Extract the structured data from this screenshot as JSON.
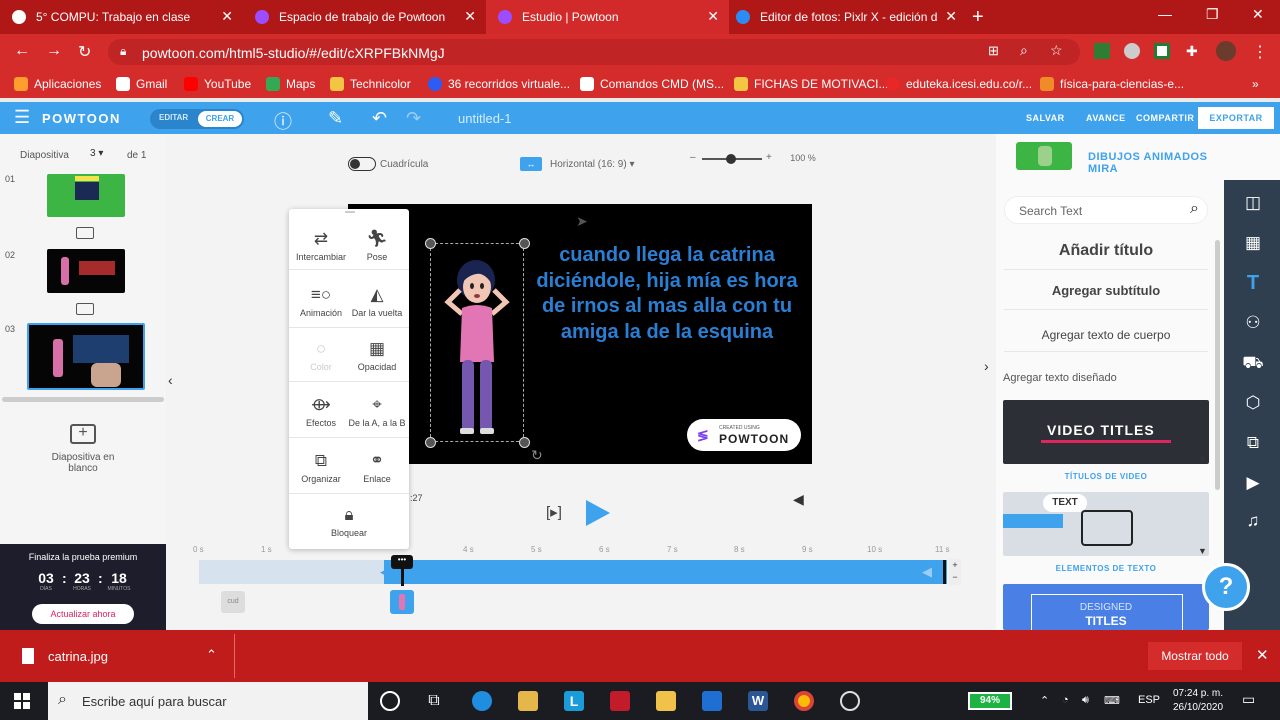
{
  "browser": {
    "tabs": [
      {
        "title": "5° COMPU: Trabajo en clase",
        "color": "#ffffff"
      },
      {
        "title": "Espacio de trabajo de Powtoon",
        "color": "#9b4dff"
      },
      {
        "title": "Estudio | Powtoon",
        "color": "#9b4dff"
      },
      {
        "title": "Editor de fotos: Pixlr X - edición d",
        "color": "#2c8cf4"
      }
    ],
    "url": "powtoon.com/html5-studio/#/edit/cXRPFBkNMgJ",
    "bookmarks": [
      {
        "label": "Aplicaciones",
        "color": "#ff9d2e"
      },
      {
        "label": "Gmail",
        "color": "#ffffff"
      },
      {
        "label": "YouTube",
        "color": "#ff0000"
      },
      {
        "label": "Maps",
        "color": "#34a853"
      },
      {
        "label": "Technicolor",
        "color": "#f4c542"
      },
      {
        "label": "36 recorridos virtuale...",
        "color": "#2c5cf4"
      },
      {
        "label": "Comandos CMD (MS...",
        "color": "#ffffff"
      },
      {
        "label": "FICHAS DE MOTIVACI...",
        "color": "#f4c542"
      },
      {
        "label": "eduteka.icesi.edu.co/r...",
        "color": "#e82727"
      },
      {
        "label": "física-para-ciencias-e...",
        "color": "#f08c28"
      }
    ]
  },
  "header": {
    "logo": "POWTOON",
    "mode_edit": "EDITAR",
    "mode_create": "CREAR",
    "filename": "untitled-1",
    "save": "SALVAR",
    "preview": "AVANCE",
    "share": "COMPARTIR",
    "export": "EXPORTAR"
  },
  "slides": {
    "label": "Diapositiva",
    "current": "3",
    "of": "de 1",
    "numbers": [
      "01",
      "02",
      "03"
    ],
    "blank_label": "Diapositiva en blanco"
  },
  "premium": {
    "title": "Finaliza la prueba premium",
    "days": "03",
    "hours": "23",
    "minutes": "18",
    "days_label": "DÍAS",
    "hours_label": "HORAS",
    "minutes_label": "MINUTOS",
    "upgrade": "Actualizar ahora"
  },
  "stage": {
    "grid_label": "Cuadrícula",
    "orientation": "Horizontal (16: 9)",
    "zoom": "100 %",
    "slide_text": "cuando llega la catrina diciéndole, hija mía es hora de irnos al mas alla con tu amiga la de la esquina",
    "credits_small": "CREATED USING",
    "credits_big": "POWTOON",
    "timecode": ":27"
  },
  "context_menu": {
    "swap": "Intercambiar",
    "pose": "Pose",
    "animation": "Animación",
    "flip": "Dar la vuelta",
    "color": "Color",
    "opacity": "Opacidad",
    "effects": "Efectos",
    "a_to_b": "De la A, a la B",
    "arrange": "Organizar",
    "link": "Enlace",
    "lock": "Bloquear"
  },
  "timeline": {
    "ticks": [
      "0 s",
      "1 s",
      "4 s",
      "5 s",
      "6 s",
      "7 s",
      "8 s",
      "9 s",
      "10 s",
      "11 s"
    ],
    "playhead_label": "•••",
    "layer_label": "cud"
  },
  "right_panel": {
    "character_name": "DIBUJOS ANIMADOS MIRA",
    "search_placeholder": "Search Text",
    "add_title": "Añadir título",
    "add_subtitle": "Agregar subtítulo",
    "add_body": "Agregar texto de cuerpo",
    "add_designed": "Agregar texto diseñado",
    "tpl1_text": "VIDEO TITLES",
    "tpl1_label": "TÍTULOS DE VIDEO",
    "tpl2_text": "TEXT",
    "tpl2_label": "ELEMENTOS DE TEXTO",
    "tpl3_text1": "DESIGNED",
    "tpl3_text2": "TITLES",
    "help": "?"
  },
  "downloads": {
    "file": "catrina.jpg",
    "show_all": "Mostrar todo"
  },
  "taskbar": {
    "search_placeholder": "Escribe aquí para buscar",
    "battery": "94%",
    "lang": "ESP",
    "time": "07:24 p. m.",
    "date": "26/10/2020"
  },
  "colors": {
    "brand_blue": "#3ea2ec",
    "chrome_red": "#d42b2b",
    "slide_text": "#2a7fd4"
  }
}
